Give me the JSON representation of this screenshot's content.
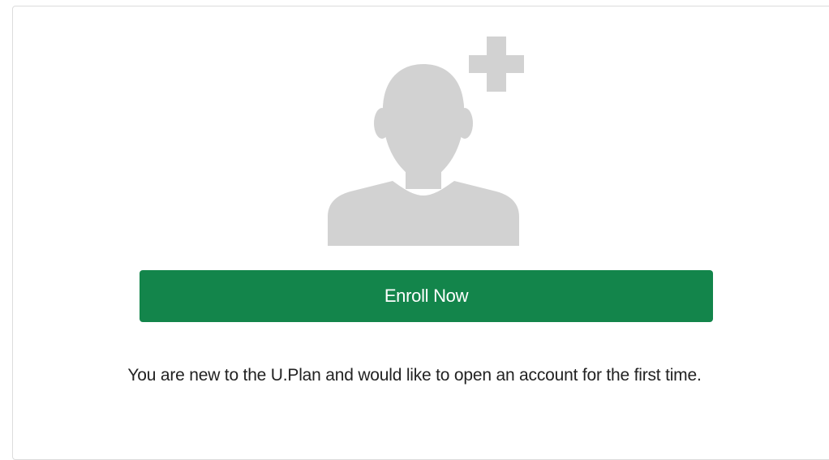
{
  "enroll_card": {
    "icon": "user-plus-icon",
    "button_label": "Enroll Now",
    "description": "You are new to the U.Plan and would like to open an account for the first time."
  },
  "colors": {
    "button_bg": "#13854b",
    "icon_gray": "#d2d2d2",
    "card_border": "#dcdcdc"
  }
}
